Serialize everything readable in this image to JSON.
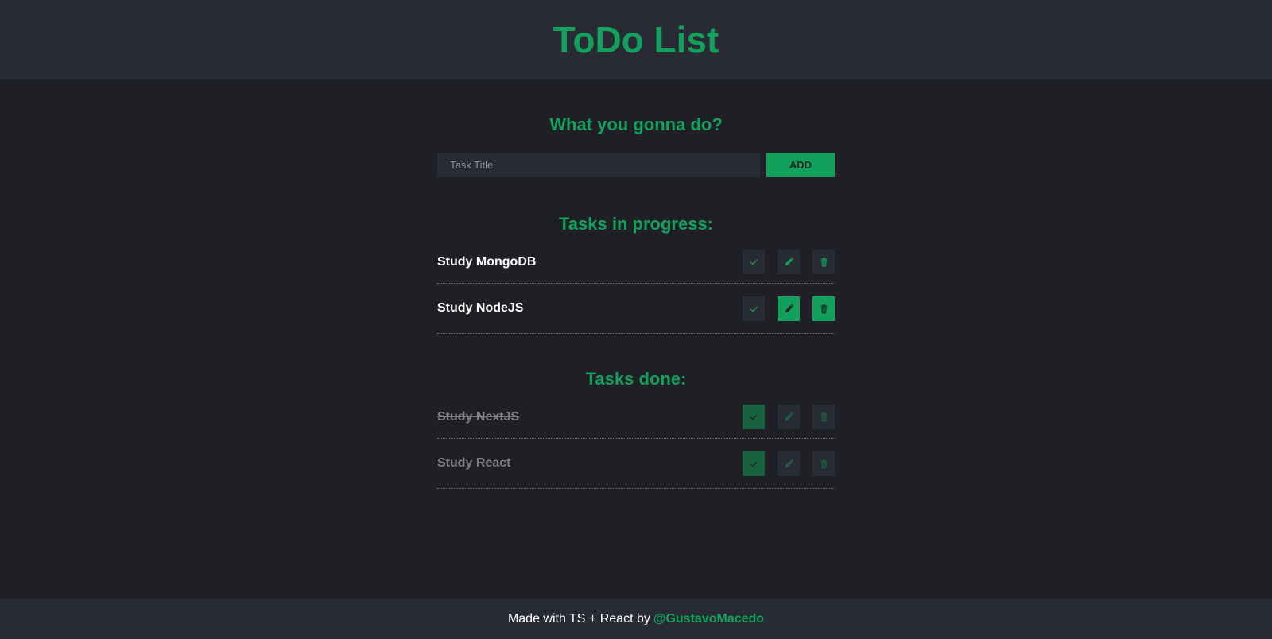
{
  "header": {
    "title": "ToDo List"
  },
  "form": {
    "heading": "What you gonna do?",
    "input_value": "",
    "input_placeholder": "Task Title",
    "add_label": "ADD"
  },
  "in_progress": {
    "heading": "Tasks in progress:",
    "tasks": [
      {
        "title": "Study MongoDB"
      },
      {
        "title": "Study NodeJS"
      }
    ]
  },
  "done": {
    "heading": "Tasks done:",
    "tasks": [
      {
        "title": "Study NextJS"
      },
      {
        "title": "Study React"
      }
    ]
  },
  "footer": {
    "text": "Made with TS + React by",
    "link": "@GustavoMacedo"
  },
  "icons": {
    "check": "check-icon",
    "edit": "pencil-icon",
    "delete": "trash-icon"
  },
  "colors": {
    "accent": "#12a05c",
    "header_bg": "#282b33",
    "page_bg": "#1f2025",
    "done_check_bg": "#18633f"
  }
}
